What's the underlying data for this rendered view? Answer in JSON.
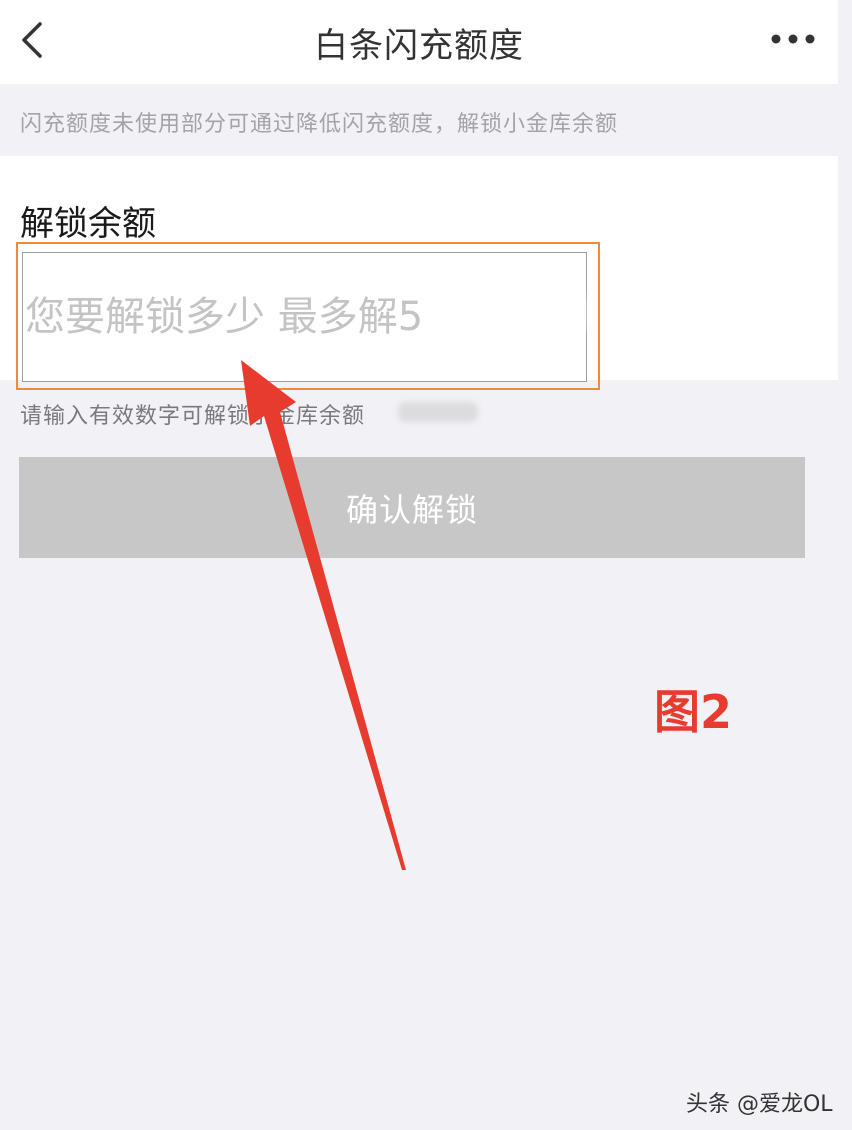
{
  "header": {
    "title": "白条闪充额度"
  },
  "notice": {
    "text": "闪充额度未使用部分可通过降低闪充额度，解锁小金库余额"
  },
  "form": {
    "label": "解锁余额",
    "input_placeholder": "您要解锁多少 最多解5",
    "hint": "请输入有效数字可解锁小金库余额"
  },
  "confirm_button": {
    "label": "确认解锁"
  },
  "annotation": {
    "figure_label": "图2",
    "arrow_color": "#e63b2e",
    "highlight_color": "#f08a3a"
  },
  "watermark": {
    "text": "头条 @爱龙OL"
  },
  "colors": {
    "background": "#f2f1f5",
    "button_disabled": "#c7c7c7"
  }
}
